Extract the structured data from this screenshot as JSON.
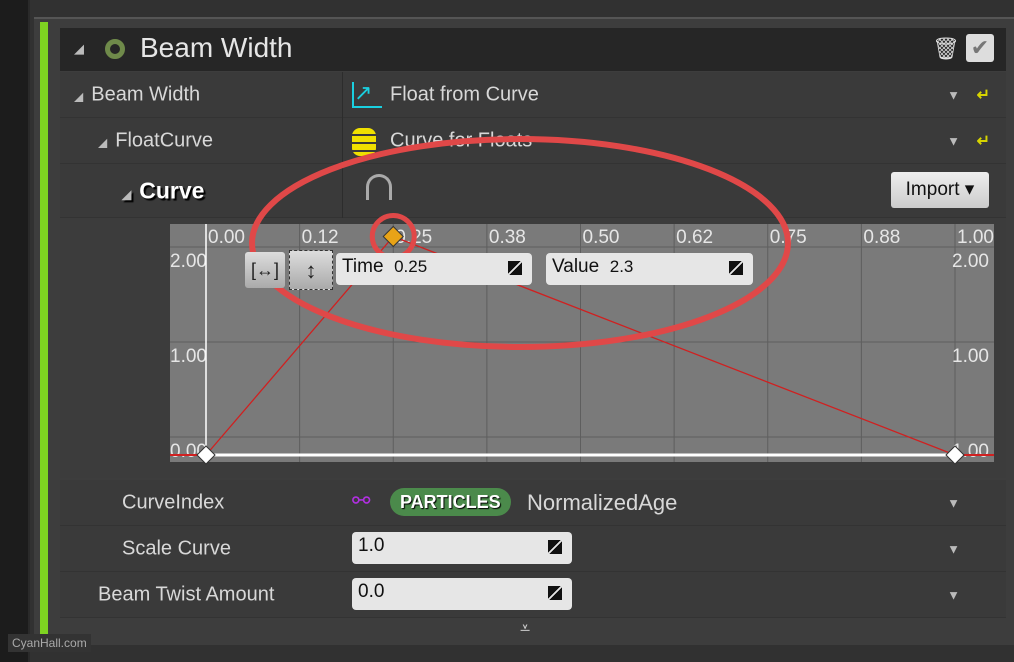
{
  "module": {
    "title": "Beam Width",
    "accent": "#7ed321"
  },
  "rows": {
    "beam_width": {
      "label": "Beam Width",
      "value": "Float from Curve"
    },
    "float_curve": {
      "label": "FloatCurve",
      "value": "Curve for Floats"
    },
    "curve": {
      "label": "Curve",
      "import_label": "Import"
    }
  },
  "graph": {
    "x_ticks": [
      "0.00",
      "0.12",
      "0.25",
      "0.38",
      "0.50",
      "0.62",
      "0.75",
      "0.88",
      "1.00"
    ],
    "y_ticks": [
      "2.00",
      "1.00",
      "0.00"
    ],
    "y_ticks_right": [
      "2.00",
      "1.00",
      "1.00"
    ],
    "keys": [
      {
        "time": 0,
        "value": 0
      },
      {
        "time": 0.25,
        "value": 2.3,
        "selected": true
      },
      {
        "time": 1,
        "value": 0
      }
    ],
    "time_label": "Time",
    "time_value": "0.25",
    "value_label": "Value",
    "value_value": "2.3",
    "curve_color": "#d02020",
    "selected_color": "#e8a317"
  },
  "curve_index": {
    "label": "CurveIndex",
    "namespace": "PARTICLES",
    "value": "NormalizedAge"
  },
  "scale_curve": {
    "label": "Scale Curve",
    "value": "1.0"
  },
  "beam_twist": {
    "label": "Beam Twist Amount",
    "value": "0.0"
  },
  "watermark": "CyanHall.com",
  "annotation_color": "#e04848"
}
